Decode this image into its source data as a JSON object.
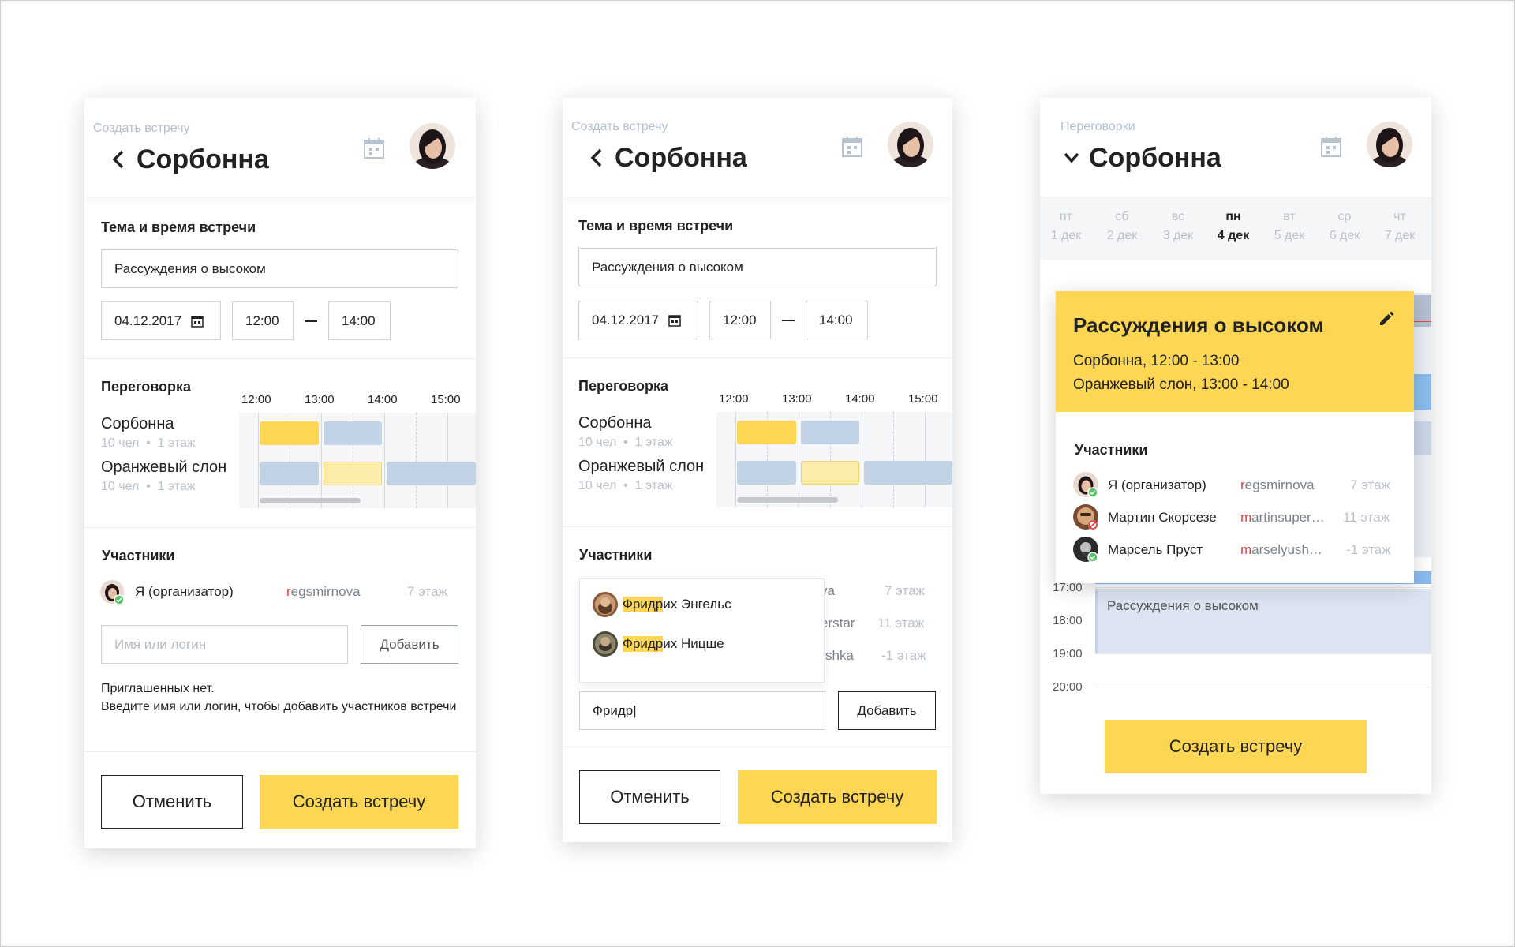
{
  "colors": {
    "accent": "#fdd654",
    "busy_blue": "#c3d3e6",
    "muted": "#bac1ca"
  },
  "screen1": {
    "breadcrumb": "Создать встречу",
    "title": "Сорбонна",
    "meeting_section": "Тема и время встречи",
    "topic_value": "Рассуждения о высоком",
    "date_value": "04.12.2017",
    "time_start": "12:00",
    "time_end": "14:00",
    "room_section": "Переговорка",
    "hours": [
      "12:00",
      "13:00",
      "14:00",
      "15:00"
    ],
    "rooms": [
      {
        "name": "Сорбонна",
        "capacity": "10 чел",
        "floor": "1 этаж"
      },
      {
        "name": "Оранжевый слон",
        "capacity": "10 чел",
        "floor": "1 этаж"
      }
    ],
    "participants_section": "Участники",
    "participant": {
      "name": "Я (организатор)",
      "login_first": "r",
      "login_rest": "egsmirnova",
      "floor": "7 этаж"
    },
    "search_placeholder": "Имя или логин",
    "add_label": "Добавить",
    "empty_line1": "Приглашенных нет.",
    "empty_line2": "Введите имя или логин, чтобы добавить участников встречи",
    "cancel_label": "Отменить",
    "create_label": "Создать встречу"
  },
  "screen2": {
    "breadcrumb": "Создать встречу",
    "title": "Сорбонна",
    "meeting_section": "Тема и время встречи",
    "topic_value": "Рассуждения о высоком",
    "date_value": "04.12.2017",
    "time_start": "12:00",
    "time_end": "14:00",
    "room_section": "Переговорка",
    "hours": [
      "12:00",
      "13:00",
      "14:00",
      "15:00"
    ],
    "rooms": [
      {
        "name": "Сорбонна",
        "capacity": "10 чел",
        "floor": "1 этаж"
      },
      {
        "name": "Оранжевый слон",
        "capacity": "10 чел",
        "floor": "1 этаж"
      }
    ],
    "participants_section": "Участники",
    "hidden_rows": [
      {
        "login_tail": "va",
        "floor": "7 этаж"
      },
      {
        "login_tail": "erstar",
        "floor": "11 этаж"
      },
      {
        "login_tail": "shka",
        "floor": "-1 этаж"
      }
    ],
    "suggestions": [
      {
        "match": "Фридр",
        "rest": "их Энгельс"
      },
      {
        "match": "Фридр",
        "rest": "их Ницше"
      }
    ],
    "search_value": "Фридр|",
    "add_label": "Добавить",
    "cancel_label": "Отменить",
    "create_label": "Создать встречу"
  },
  "screen3": {
    "breadcrumb": "Переговорки",
    "title": "Сорбонна",
    "days": [
      {
        "dow": "пт",
        "date": "1 дек"
      },
      {
        "dow": "сб",
        "date": "2 дек"
      },
      {
        "dow": "вс",
        "date": "3 дек"
      },
      {
        "dow": "пн",
        "date": "4 дек"
      },
      {
        "dow": "вт",
        "date": "5 дек"
      },
      {
        "dow": "ср",
        "date": "6 дек"
      },
      {
        "dow": "чт",
        "date": "7 дек"
      }
    ],
    "hours": [
      "17:00",
      "18:00",
      "19:00",
      "20:00"
    ],
    "event_label": "Рассуждения о высоком",
    "popup": {
      "title": "Рассуждения о высоком",
      "line1": "Сорбонна, 12:00 - 13:00",
      "line2": "Оранжевый слон, 13:00 - 14:00",
      "participants_section": "Участники",
      "participants": [
        {
          "name": "Я (организатор)",
          "login_first": "r",
          "login_rest": "egsmirnova",
          "floor": "7 этаж"
        },
        {
          "name": "Мартин Скорсезе",
          "login_first": "m",
          "login_rest": "artinsuper…",
          "floor": "11 этаж"
        },
        {
          "name": "Марсель Пруст",
          "login_first": "m",
          "login_rest": "arselyush…",
          "floor": "-1 этаж"
        }
      ]
    },
    "create_label": "Создать встречу"
  }
}
